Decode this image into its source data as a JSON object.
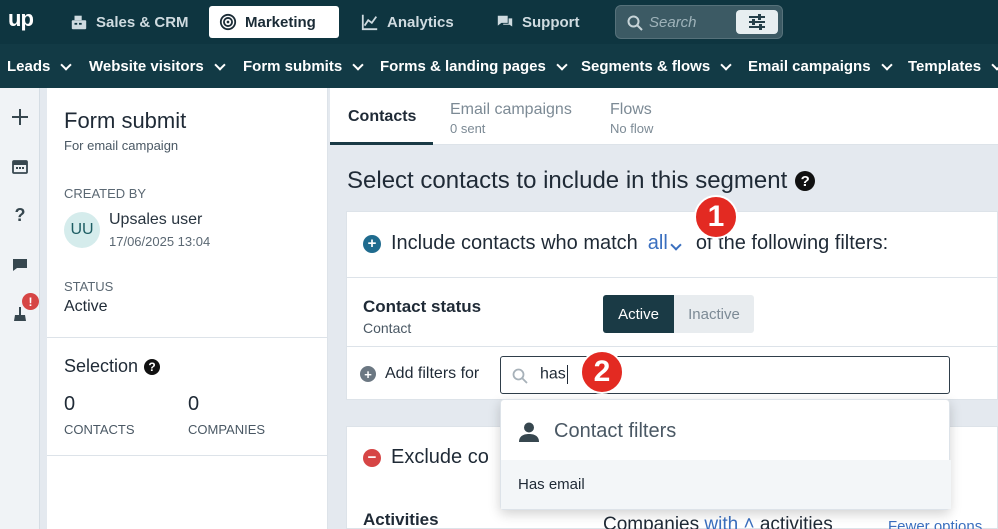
{
  "topbar": {
    "logo": "up",
    "nav": [
      {
        "label": "Sales & CRM",
        "icon": "cash-register-icon"
      },
      {
        "label": "Marketing",
        "icon": "bullseye-icon",
        "active": true
      },
      {
        "label": "Analytics",
        "icon": "chart-line-icon"
      },
      {
        "label": "Support",
        "icon": "chat-bubbles-icon"
      }
    ],
    "search_placeholder": "Search"
  },
  "subnav": {
    "items": [
      "Leads",
      "Website visitors",
      "Form submits",
      "Forms & landing pages",
      "Segments & flows",
      "Email campaigns",
      "Templates"
    ]
  },
  "rail": {
    "icons": [
      "plus-icon",
      "calendar-icon",
      "help-icon",
      "chat-icon",
      "broom-icon"
    ],
    "badge": "!"
  },
  "info": {
    "title": "Form submit",
    "subtitle": "For email campaign",
    "created_by_label": "CREATED BY",
    "avatar_initials": "UU",
    "user_name": "Upsales user",
    "created_date": "17/06/2025 13:04",
    "status_label": "STATUS",
    "status_value": "Active",
    "selection_title": "Selection",
    "contacts_count": "0",
    "contacts_label": "CONTACTS",
    "companies_count": "0",
    "companies_label": "COMPANIES"
  },
  "tabs": {
    "contacts": "Contacts",
    "email_campaigns_title": "Email campaigns",
    "email_campaigns_sub": "0 sent",
    "flows_title": "Flows",
    "flows_sub": "No flow"
  },
  "main": {
    "heading": "Select contacts to include in this segment",
    "include_prefix": "Include contacts who match",
    "include_match": "all",
    "include_suffix": "of the following filters:",
    "contact_status_title": "Contact status",
    "contact_status_sub": "Contact",
    "status_active": "Active",
    "status_inactive": "Inactive",
    "add_filters_label": "Add filters for",
    "filter_search_value": "has",
    "dropdown_header": "Contact filters",
    "dropdown_item": "Has email",
    "exclude_label": "Exclude co",
    "activities_title": "Activities",
    "companies_prefix": "Companies",
    "companies_with": "with",
    "companies_suffix": "activities",
    "fewer_options": "Fewer options"
  },
  "markers": [
    "1",
    "2"
  ],
  "colors": {
    "topbar": "#0e3540",
    "subnav": "#123a45",
    "accent_dark": "#1a3a45",
    "link_blue": "#3a6fbf",
    "marker_red": "#e32a22"
  }
}
